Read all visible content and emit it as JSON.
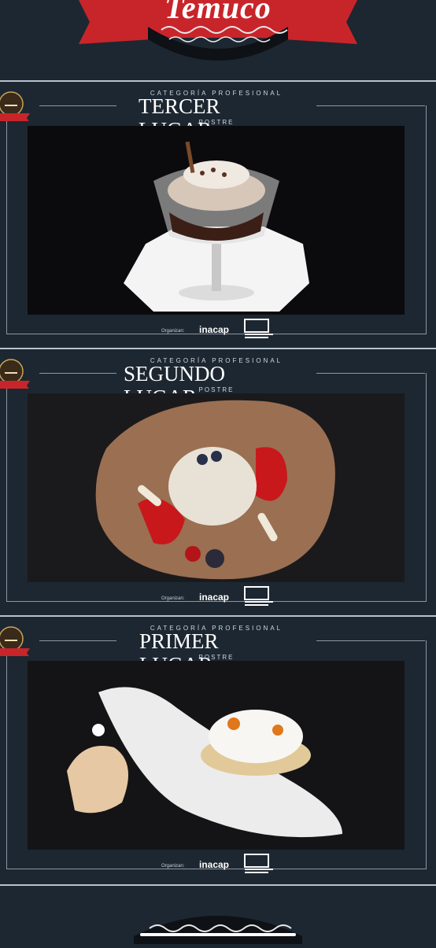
{
  "header": {
    "title": "Temuco"
  },
  "panels": [
    {
      "category": "CATEGORÍA PROFESIONAL",
      "postre": "POSTRE",
      "place": "TERCER LUGAR",
      "organizers_label": "Organizan:",
      "sponsor1": "inacap"
    },
    {
      "category": "CATEGORÍA PROFESIONAL",
      "postre": "POSTRE",
      "place": "SEGUNDO LUGAR",
      "organizers_label": "Organizan:",
      "sponsor1": "inacap"
    },
    {
      "category": "CATEGORÍA PROFESIONAL",
      "postre": "POSTRE",
      "place": "PRIMER LUGAR",
      "organizers_label": "Organizan:",
      "sponsor1": "inacap"
    }
  ],
  "colors": {
    "background": "#1d2731",
    "banner_red": "#c8252b",
    "frame": "#8c97a3"
  }
}
